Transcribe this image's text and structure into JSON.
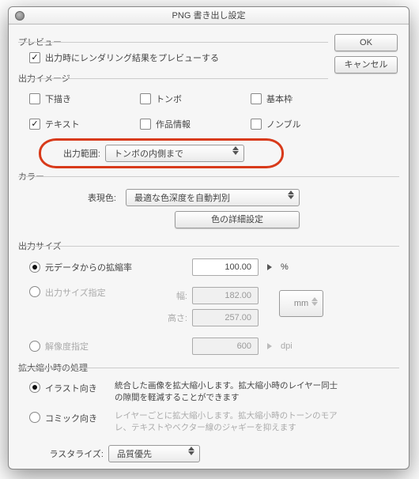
{
  "title": "PNG 書き出し設定",
  "buttons": {
    "ok": "OK",
    "cancel": "キャンセル"
  },
  "preview": {
    "header": "プレビュー",
    "render_label": "出力時にレンダリング結果をプレビューする",
    "render_checked": true
  },
  "output_image": {
    "header": "出力イメージ",
    "draft": {
      "label": "下描き",
      "checked": false
    },
    "trim": {
      "label": "トンボ",
      "checked": false
    },
    "frame": {
      "label": "基本枠",
      "checked": false
    },
    "text": {
      "label": "テキスト",
      "checked": true
    },
    "info": {
      "label": "作品情報",
      "checked": false
    },
    "page": {
      "label": "ノンブル",
      "checked": false
    },
    "range_label": "出力範囲:",
    "range_value": "トンボの内側まで"
  },
  "color": {
    "header": "カラー",
    "mode_label": "表現色:",
    "mode_value": "最適な色深度を自動判別",
    "detail_btn": "色の詳細設定"
  },
  "size": {
    "header": "出力サイズ",
    "scale_label": "元データからの拡縮率",
    "scale_value": "100.00",
    "scale_unit": "%",
    "specify_label": "出力サイズ指定",
    "width_label": "幅:",
    "width_value": "182.00",
    "height_label": "高さ:",
    "height_value": "257.00",
    "unit_value": "mm",
    "dpi_label": "解像度指定",
    "dpi_value": "600",
    "dpi_unit": "dpi",
    "selected": "scale"
  },
  "scaling": {
    "header": "拡大縮小時の処理",
    "illust_label": "イラスト向き",
    "illust_desc": "統合した画像を拡大縮小します。拡大縮小時のレイヤー同士の隙間を軽減することができます",
    "comic_label": "コミック向き",
    "comic_desc": "レイヤーごとに拡大縮小します。拡大縮小時のトーンのモアレ、テキストやベクター線のジャギーを抑えます",
    "selected": "illust"
  },
  "rasterize": {
    "label": "ラスタライズ:",
    "value": "品質優先"
  }
}
